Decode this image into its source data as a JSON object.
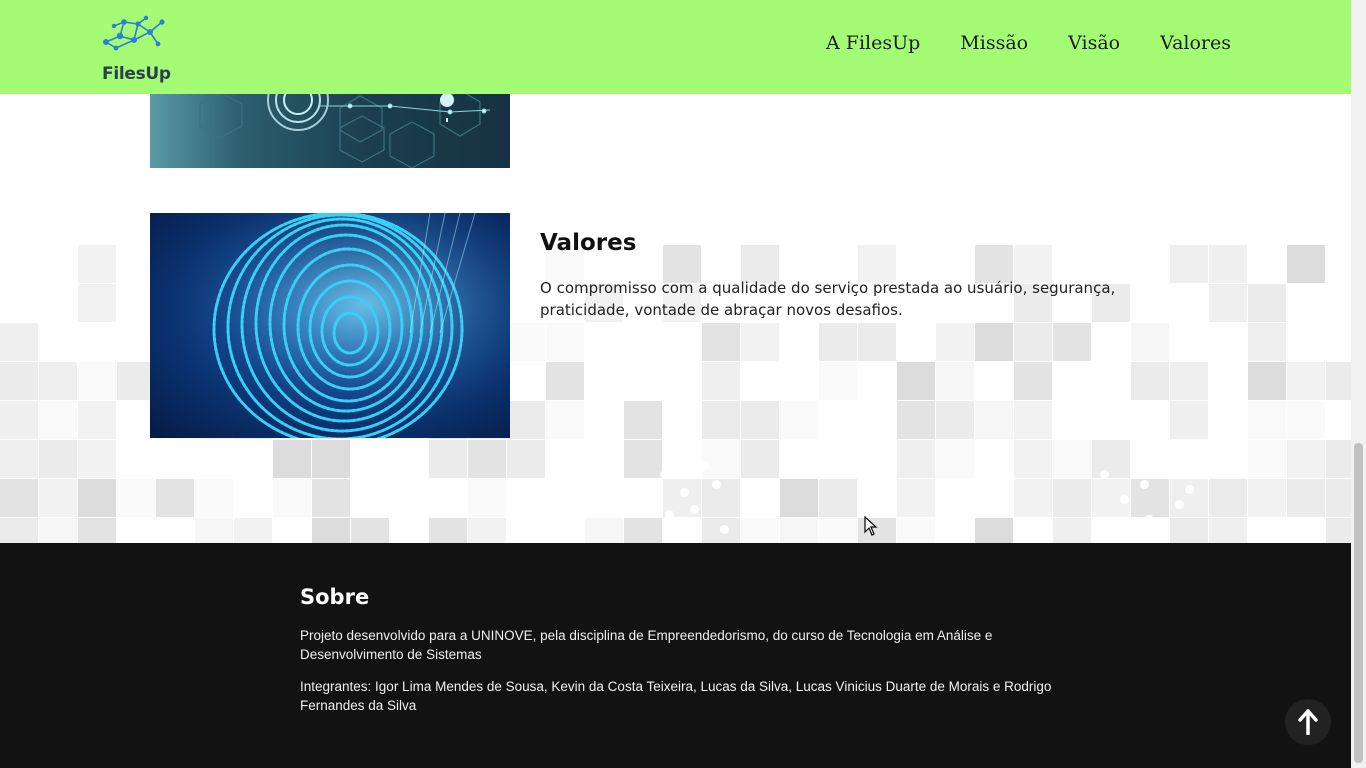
{
  "header": {
    "brand": "FilesUp",
    "nav": [
      "A FilesUp",
      "Missão",
      "Visão",
      "Valores"
    ],
    "background": "#a4fc74"
  },
  "valores": {
    "title": "Valores",
    "text": "O compromisso com a qualidade do serviço prestada ao usuário, segurança, praticidade, vontade de abraçar novos desafios."
  },
  "footer": {
    "title": "Sobre",
    "paragraph1": "Projeto desenvolvido para a UNINOVE, pela disciplina de Empreendedorismo, do curso de Tecnologia em Análise e Desenvolvimento de Sistemas",
    "paragraph2": "Integrantes: Igor Lima Mendes de Sousa, Kevin da Costa Teixeira, Lucas da Silva, Lucas Vinicius Duarte de Morais e Rodrigo Fernandes da Silva",
    "background": "#121212"
  },
  "icons": {
    "back_to_top": "arrow-up-icon",
    "logo": "network-nodes-icon"
  }
}
